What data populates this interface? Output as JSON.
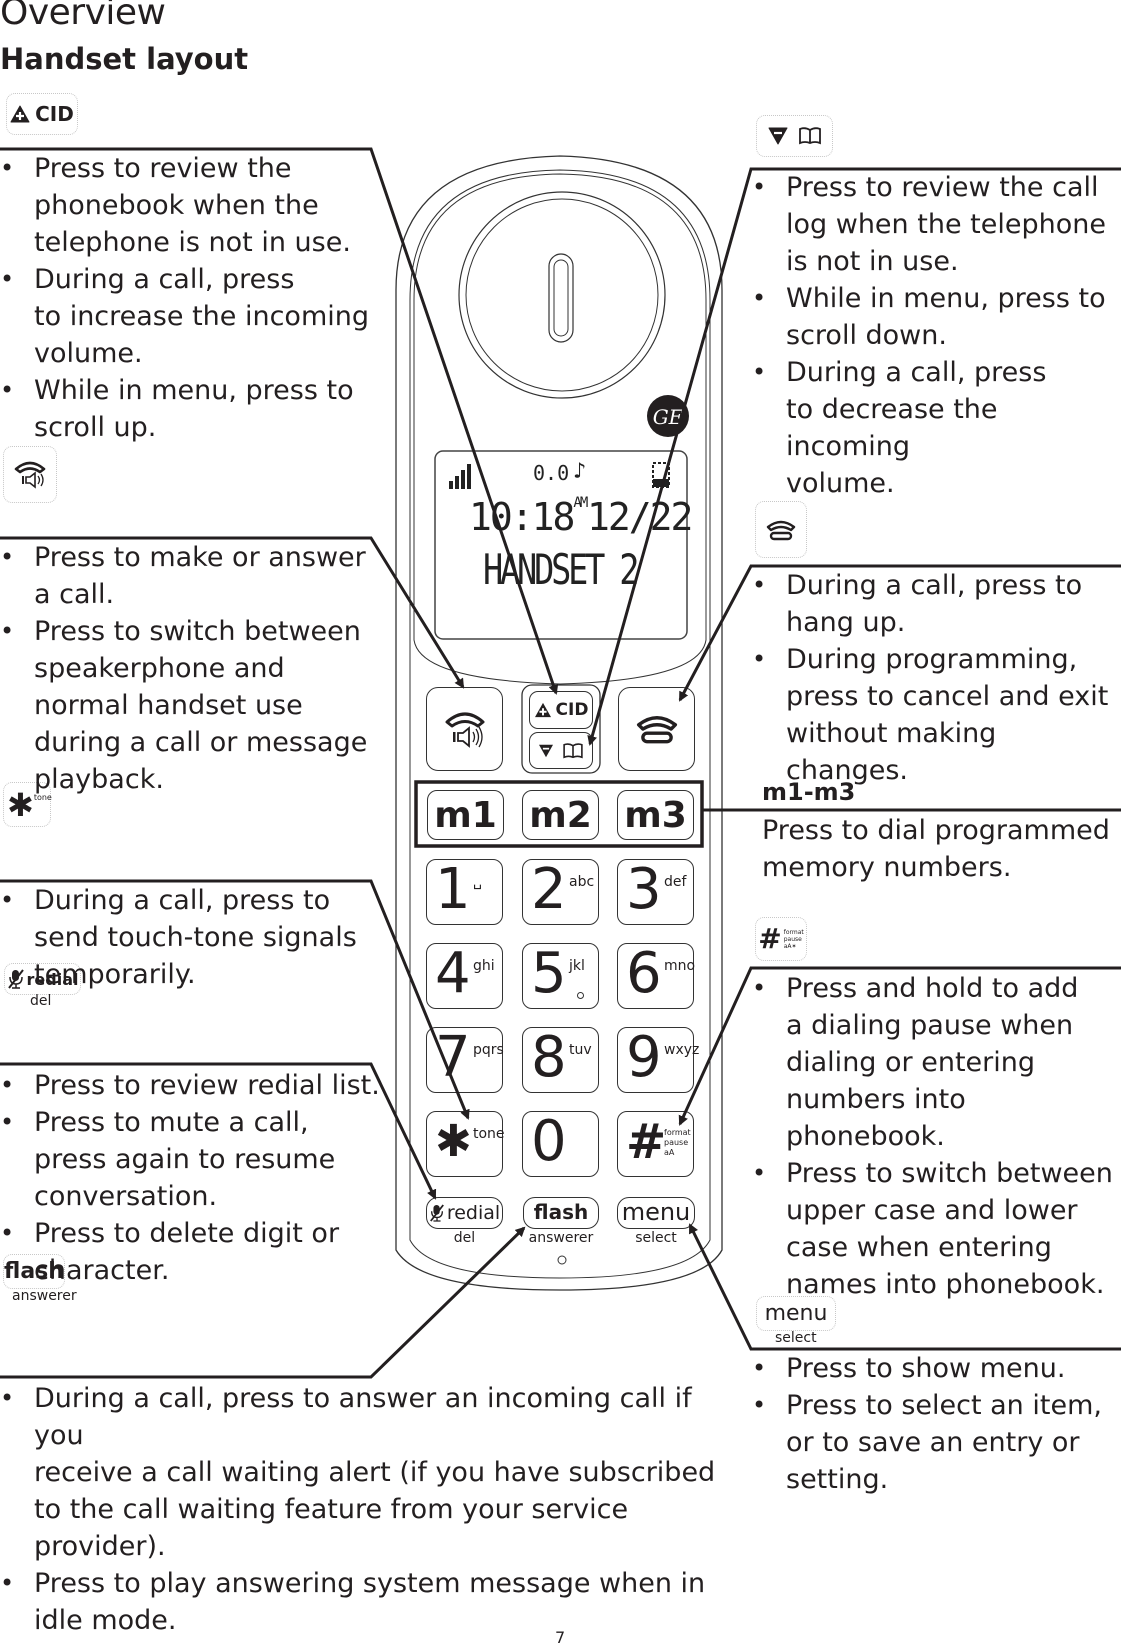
{
  "header": {
    "title": "Overview",
    "subtitle": "Handset layout"
  },
  "callouts": {
    "cid_up": {
      "icon": "cid-up-icon",
      "label": "CID",
      "bullets": [
        "Press to review the phonebook when the telephone is not in use.",
        "During a call, press to increase the incoming volume.",
        "While in menu, press to scroll up."
      ],
      "lines": [
        [
          "Press to review the",
          "phonebook when the",
          "telephone is not in use."
        ],
        [
          "During a call, press",
          "to increase the incoming",
          "volume."
        ],
        [
          "While in menu, press to",
          "scroll up."
        ]
      ]
    },
    "speaker": {
      "icon": "talk-speaker-icon",
      "lines": [
        [
          "Press to make or answer",
          "a call."
        ],
        [
          "Press to switch between",
          "speakerphone and",
          "normal handset use",
          "during a call or message",
          "playback."
        ]
      ]
    },
    "tone": {
      "icon": "star-tone-icon",
      "label": "tone",
      "lines": [
        [
          "During a call, press to",
          "send touch-tone signals",
          "temporarily."
        ]
      ]
    },
    "redial": {
      "icon": "mute-redial-icon",
      "label": "redial",
      "sublabel": "del",
      "lines": [
        [
          "Press to review redial list."
        ],
        [
          "Press to mute a call,",
          "press again to resume",
          "conversation."
        ],
        [
          "Press to delete digit or",
          "character."
        ]
      ]
    },
    "flash": {
      "label": "flash",
      "sublabel": "answerer",
      "lines": [
        [
          "During a call, press to answer an incoming call if you",
          "receive a call waiting alert (if you have subscribed",
          "to the call waiting feature from your service provider)."
        ],
        [
          "Press to play answering system message when in",
          "idle mode."
        ]
      ]
    },
    "down_book": {
      "icon": "down-phonebook-icon",
      "lines": [
        [
          "Press to review the call",
          "log when the telephone",
          "is not in use."
        ],
        [
          "While in menu, press to",
          "scroll down."
        ],
        [
          "During a call, press",
          "to decrease the incoming",
          "volume."
        ]
      ]
    },
    "off": {
      "icon": "hang-up-icon",
      "lines": [
        [
          "During a call, press to",
          "hang up."
        ],
        [
          "During programming,",
          "press to cancel and exit",
          "without making changes."
        ]
      ]
    },
    "memory": {
      "heading": "m1-m3",
      "lines": [
        "Press to dial programmed",
        "memory numbers."
      ]
    },
    "pound": {
      "icon": "pound-format-icon",
      "label_lines": [
        "format",
        "pause",
        "aA✶"
      ],
      "lines": [
        [
          "Press and hold to add",
          "a dialing pause when",
          "dialing or entering",
          "numbers into phonebook."
        ],
        [
          "Press to switch between",
          "upper case and lower",
          "case when entering",
          "names into phonebook."
        ]
      ]
    },
    "menu": {
      "label": "menu",
      "sublabel": "select",
      "lines": [
        [
          "Press to show menu."
        ],
        [
          "Press to select an item,",
          "or to save an entry or",
          "setting."
        ]
      ]
    }
  },
  "handset": {
    "brand": "GE",
    "display": {
      "time": "10:18",
      "ampm": "AM",
      "date": "12/22",
      "line2": "HANDSET 2",
      "status": "0.0"
    },
    "nav_keys": {
      "up_label": "CID"
    },
    "memory_keys": [
      "m1",
      "m2",
      "m3"
    ],
    "keypad": [
      {
        "num": "1",
        "letters": "␣"
      },
      {
        "num": "2",
        "letters": "abc"
      },
      {
        "num": "3",
        "letters": "def"
      },
      {
        "num": "4",
        "letters": "ghi"
      },
      {
        "num": "5",
        "letters": "jkl"
      },
      {
        "num": "6",
        "letters": "mno"
      },
      {
        "num": "7",
        "letters": "pqrs"
      },
      {
        "num": "8",
        "letters": "tuv"
      },
      {
        "num": "9",
        "letters": "wxyz"
      },
      {
        "num": "✱",
        "letters": "tone"
      },
      {
        "num": "0",
        "letters": ""
      },
      {
        "num": "#",
        "letters": "format pause aA"
      }
    ],
    "soft_keys": [
      {
        "label": "redial",
        "sub": "del"
      },
      {
        "label": "flash",
        "sub": "answerer"
      },
      {
        "label": "menu",
        "sub": "select"
      }
    ]
  },
  "footer": {
    "page_number": "7"
  }
}
